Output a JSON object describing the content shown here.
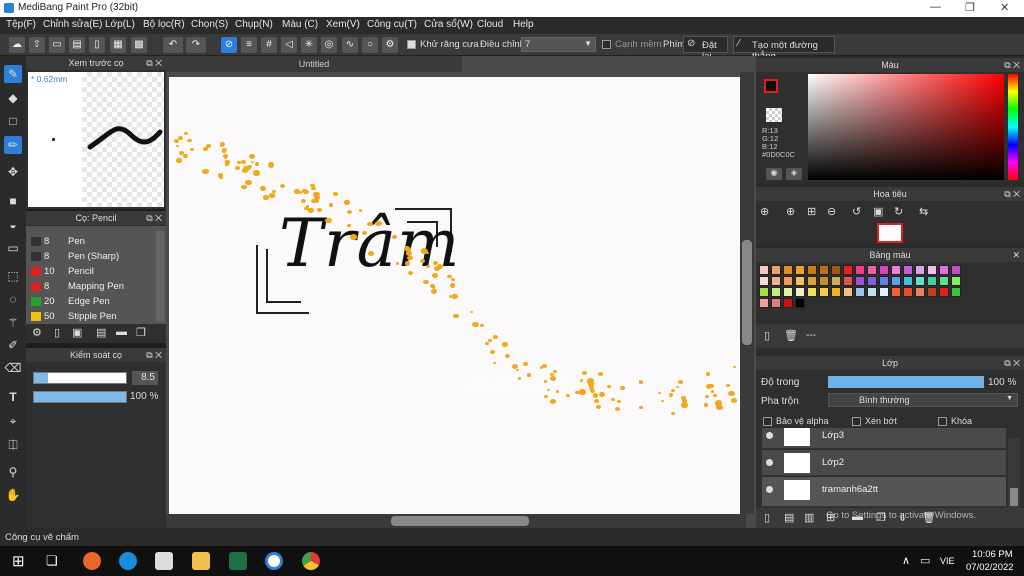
{
  "titlebar": {
    "title": "MediBang Paint Pro (32bit)"
  },
  "menu": [
    "Tệp(F)",
    "Chỉnh sửa(E)",
    "Lớp(L)",
    "Bộ lọc(R)",
    "Chọn(S)",
    "Chụp(N)",
    "Màu (C)",
    "Xem(V)",
    "Công cụ(T)",
    "Cửa sổ(W)",
    "Cloud",
    "Help"
  ],
  "toolbar": {
    "antialias_label": "Khử răng cưa",
    "adjust_label": "Điều chỉnh",
    "adjust_value": "7",
    "edge_label": "Cạnh mềm",
    "key_label": "Phím",
    "reset_label": "Đặt lại",
    "line_label": "Tạo một đường thẳng"
  },
  "preview": {
    "title": "Xem trước cọ",
    "size": "* 0.62mm"
  },
  "brushes": {
    "title": "Cọ: Pencil",
    "items": [
      {
        "size": "8",
        "name": "Pen",
        "color": "#333333"
      },
      {
        "size": "8",
        "name": "Pen (Sharp)",
        "color": "#333333"
      },
      {
        "size": "10",
        "name": "Pencil",
        "color": "#e02020"
      },
      {
        "size": "8",
        "name": "Mapping Pen",
        "color": "#e02020"
      },
      {
        "size": "20",
        "name": "Edge Pen",
        "color": "#2ca02c"
      },
      {
        "size": "50",
        "name": "Stipple Pen",
        "color": "#f2c200"
      }
    ]
  },
  "brush_control": {
    "title": "Kiểm soát cọ",
    "size_value": "8.5",
    "opacity_value": "100 %",
    "opacity_level": 1.0
  },
  "canvas": {
    "tab_title": "Untitled",
    "handwriting": "Trâm"
  },
  "color_panel": {
    "title": "Màu",
    "r": "R:13",
    "g": "G:12",
    "b": "B:12",
    "hex": "#0D0C0C"
  },
  "navigator": {
    "title": "Hoa tiêu"
  },
  "palette": {
    "title": "Bảng màu",
    "more": "---",
    "colors": [
      "#f7c6c6",
      "#f0a070",
      "#e88a2a",
      "#f0a020",
      "#d07818",
      "#c07010",
      "#a05808",
      "#e82020",
      "#f04080",
      "#f060a0",
      "#e040c0",
      "#f080d0",
      "#c060e0",
      "#e0a0f0",
      "#f0c0f0",
      "#e070e0",
      "#c050c0",
      "#f8d8d8",
      "#f0b090",
      "#f0a050",
      "#f0c060",
      "#e0a030",
      "#c09030",
      "#d0b060",
      "#e05050",
      "#a050d0",
      "#8060e0",
      "#6080f0",
      "#60a0f0",
      "#40c0e0",
      "#60e0d0",
      "#40d0a0",
      "#60e080",
      "#80f060",
      "#a0e040",
      "#c0f080",
      "#e0f0a0",
      "#f0f0c0",
      "#f0e060",
      "#f0d040",
      "#f0b020",
      "#f0c080",
      "#a0c0f0",
      "#c0e0f0",
      "#e0f0ff",
      "#f06030",
      "#e05030",
      "#f08060",
      "#c04020",
      "#e02020",
      "#40c040",
      "#f0a0a0",
      "#e08080",
      "#d01010",
      "#000000"
    ]
  },
  "layers_panel": {
    "title": "Lớp",
    "opacity_label": "Độ trong",
    "opacity_value": "100 %",
    "opacity_level": 1.0,
    "blend_label": "Pha trộn",
    "blend_value": "Bình thường",
    "protect_alpha": "Bảo vệ alpha",
    "clipping": "Xén bớt",
    "lock": "Khóa",
    "layers": [
      {
        "name": "Lớp3"
      },
      {
        "name": "Lớp2"
      },
      {
        "name": "tramanh6a2tt"
      }
    ]
  },
  "watermark": {
    "line1": "Activate Windows",
    "line2": "Go to Settings to activate Windows."
  },
  "status": {
    "text": "Công cụ vẽ chấm"
  },
  "taskbar": {
    "lang": "VIE",
    "time": "10:06 PM",
    "date": "07/02/2022"
  }
}
